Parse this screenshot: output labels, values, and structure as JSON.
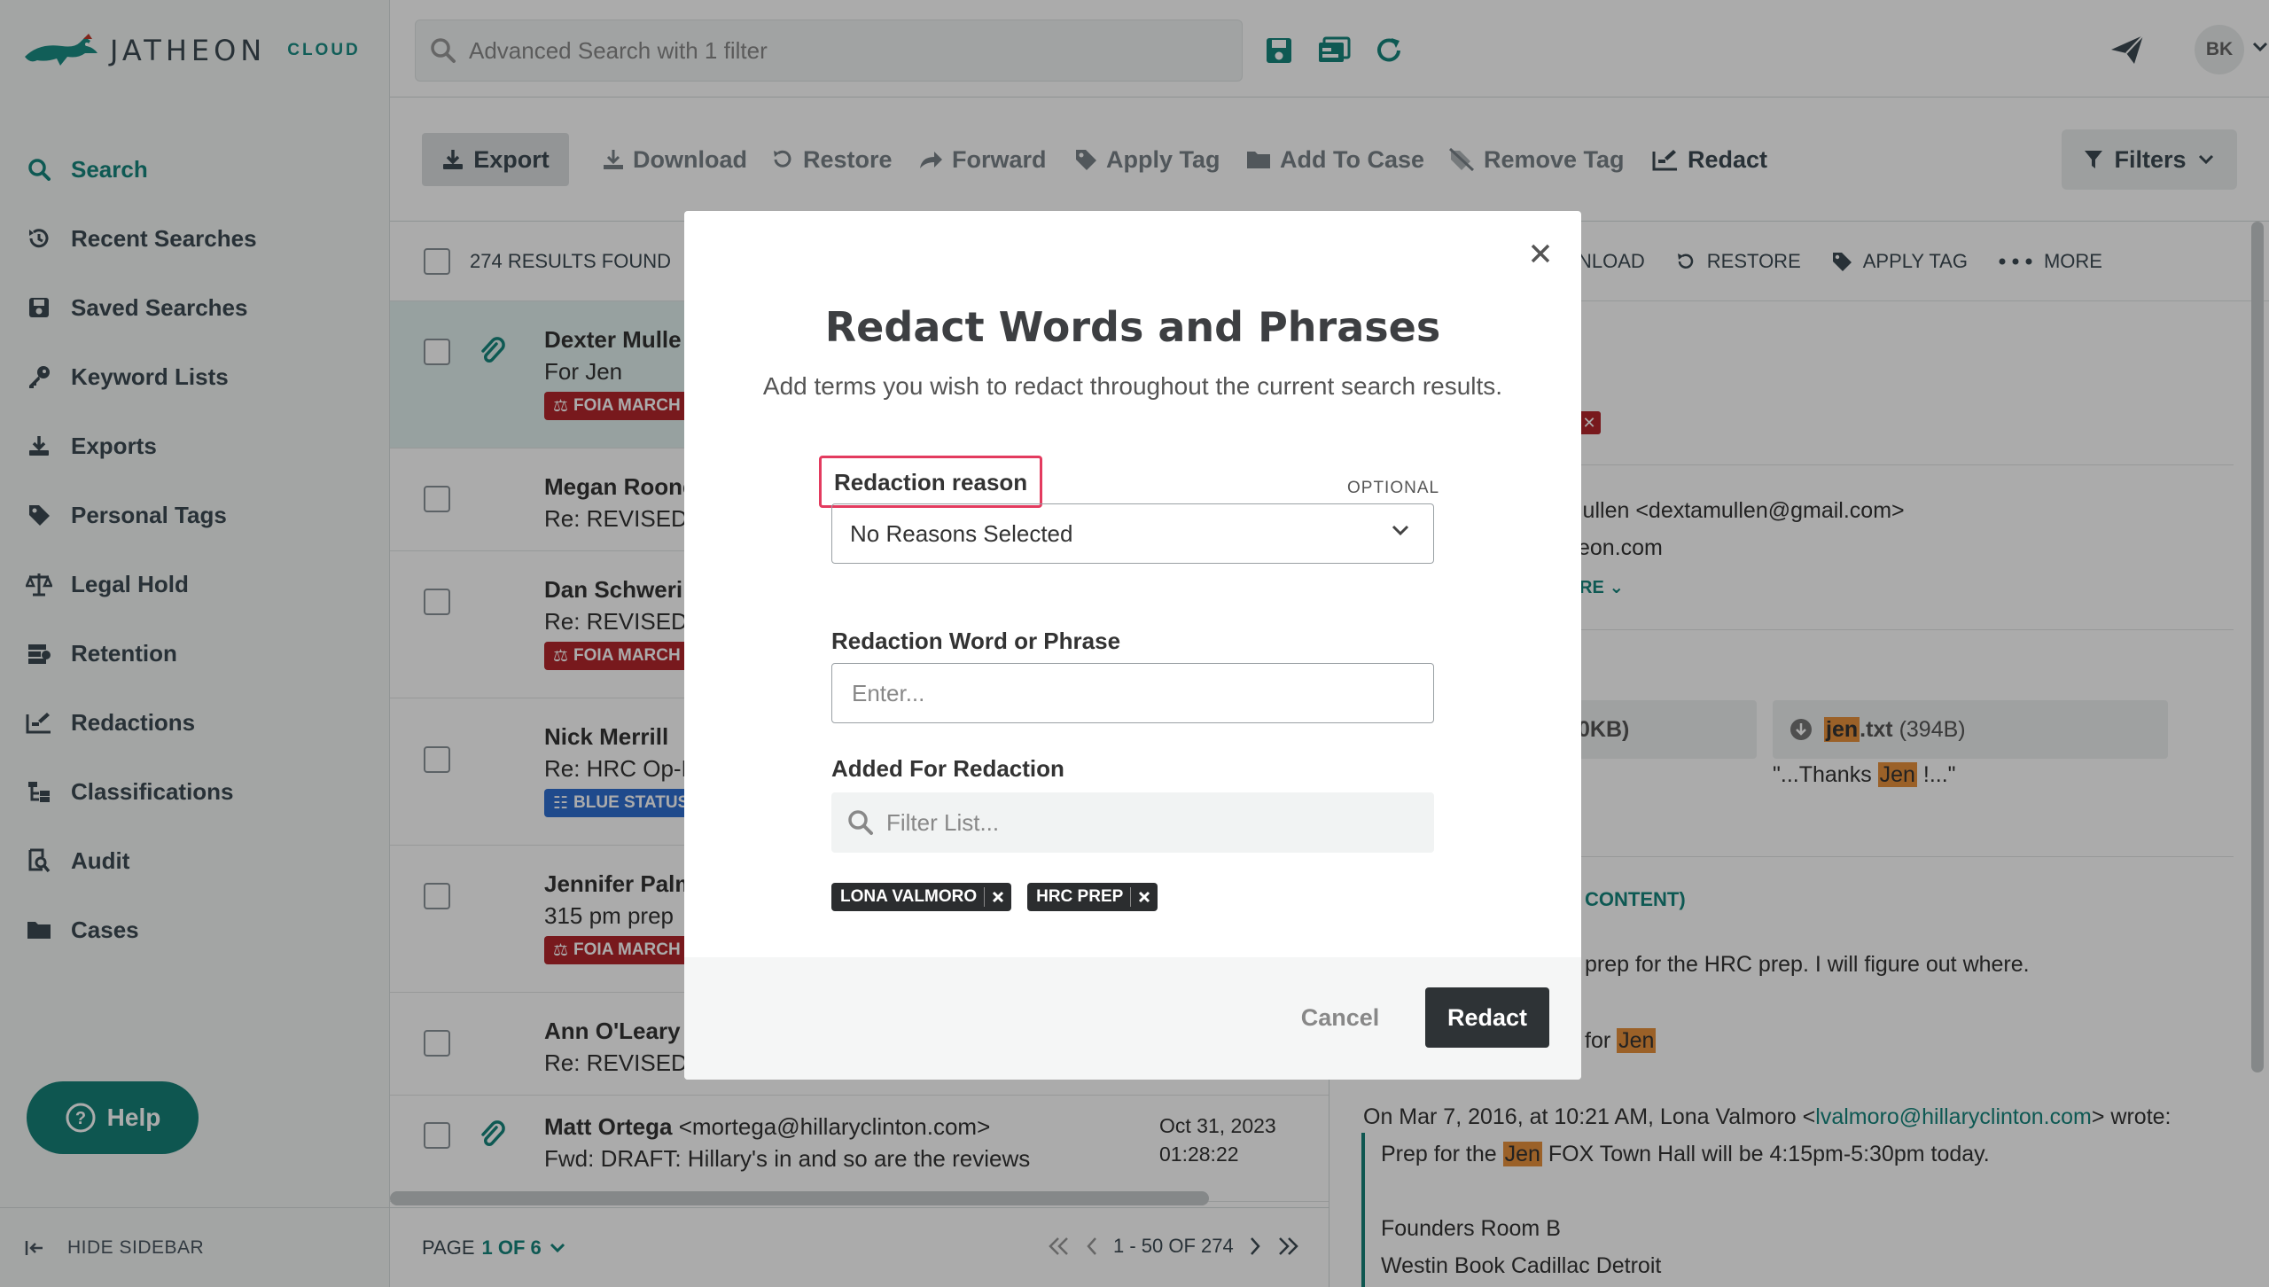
{
  "app": {
    "logo_text": "JATHEON",
    "logo_cloud": "CLOUD"
  },
  "sidebar": {
    "items": [
      {
        "label": "Search",
        "icon": "search-icon",
        "active": true
      },
      {
        "label": "Recent Searches",
        "icon": "history-icon"
      },
      {
        "label": "Saved Searches",
        "icon": "save-icon"
      },
      {
        "label": "Keyword Lists",
        "icon": "key-icon"
      },
      {
        "label": "Exports",
        "icon": "export-icon"
      },
      {
        "label": "Personal Tags",
        "icon": "tag-icon"
      },
      {
        "label": "Legal Hold",
        "icon": "scale-icon"
      },
      {
        "label": "Retention",
        "icon": "retention-icon"
      },
      {
        "label": "Redactions",
        "icon": "redact-icon"
      },
      {
        "label": "Classifications",
        "icon": "classification-icon"
      },
      {
        "label": "Audit",
        "icon": "audit-icon"
      },
      {
        "label": "Cases",
        "icon": "folder-icon"
      }
    ],
    "help_label": "Help",
    "hide_label": "HIDE SIDEBAR"
  },
  "topbar": {
    "search_placeholder": "Advanced Search with 1 filter",
    "avatar_initials": "BK"
  },
  "toolbar": {
    "export": "Export",
    "download": "Download",
    "restore": "Restore",
    "forward": "Forward",
    "apply_tag": "Apply Tag",
    "add_to_case": "Add To Case",
    "remove_tag": "Remove Tag",
    "redact": "Redact",
    "filters": "Filters"
  },
  "results": {
    "count_label": "274 RESULTS FOUND",
    "rows": [
      {
        "sender": "Dexter Mulle",
        "subject": "For Jen",
        "tag": "FOIA MARCH",
        "tag_color": "#b3262c",
        "attachment": true
      },
      {
        "sender": "Megan Roone",
        "subject": "Re: REVISED F",
        "tag": "",
        "attachment": false
      },
      {
        "sender": "Dan Schweri",
        "subject": "Re: REVISED F",
        "tag": "FOIA MARCH",
        "tag_color": "#b3262c",
        "attachment": false
      },
      {
        "sender": "Nick Merrill",
        "subject": "Re: HRC Op-E",
        "tag": "BLUE STATUS",
        "tag_color": "#2f6fd1",
        "attachment": false
      },
      {
        "sender": "Jennifer Palm",
        "subject": "315 pm prep",
        "tag": "FOIA MARCH",
        "tag_color": "#b3262c",
        "attachment": false
      },
      {
        "sender": "Ann O'Leary",
        "subject": "Re: REVISED F",
        "tag": "",
        "attachment": false
      },
      {
        "sender": "Matt Ortega",
        "email": "<mortega@hillaryclinton.com>",
        "subject": "Fwd: DRAFT: Hillary's in and so are the reviews",
        "date": "Oct 31, 2023",
        "time": "01:28:22",
        "attachment": true
      }
    ],
    "pager": {
      "page_label": "PAGE",
      "page_value": "1 OF 6",
      "range": "1 - 50 OF 274"
    }
  },
  "preview": {
    "actions": {
      "download": "NLOAD",
      "restore": "RESTORE",
      "apply_tag": "APPLY TAG",
      "more": "MORE"
    },
    "from_line": "lullen <dextamullen@gmail.com>",
    "to_line": "eon.com",
    "more_toggle": "RE",
    "attachment1": "0KB)",
    "attachment2_name_hl": "jen",
    "attachment2_name": ".txt",
    "attachment2_size": "(394B)",
    "snippet_pre": "\"...Thanks ",
    "snippet_hl": "Jen",
    "snippet_post": " !...\"",
    "content_label": "CONTENT)",
    "body_line1": "prep for the HRC prep.  I will figure out where.",
    "body_line2_pre": "for ",
    "body_line2_hl": "Jen",
    "quote_header_pre": "On Mar 7, 2016, at 10:21 AM, Lona Valmoro <",
    "quote_header_link": "lvalmoro@hillaryclinton.com",
    "quote_header_post": "> wrote:",
    "quote_line1_pre": "Prep for the ",
    "quote_line1_hl": "Jen",
    "quote_line1_post": " FOX Town Hall will be 4:15pm-5:30pm today.",
    "quote_line2": "Founders Room B",
    "quote_line3": "Westin Book Cadillac Detroit"
  },
  "modal": {
    "title": "Redact Words and Phrases",
    "subtitle": "Add terms you wish to redact throughout the current search results.",
    "reason_label": "Redaction reason",
    "optional_label": "OPTIONAL",
    "reason_value": "No Reasons Selected",
    "word_label": "Redaction Word or Phrase",
    "word_placeholder": "Enter...",
    "added_label": "Added For Redaction",
    "filter_placeholder": "Filter List...",
    "chips": [
      "LONA VALMORO",
      "HRC PREP"
    ],
    "cancel": "Cancel",
    "redact": "Redact"
  },
  "colors": {
    "accent": "#15857d",
    "danger_tag": "#b3262c",
    "blue_tag": "#2f6fd1",
    "highlight": "#e8913c",
    "focus_outline": "#e33b5f"
  }
}
